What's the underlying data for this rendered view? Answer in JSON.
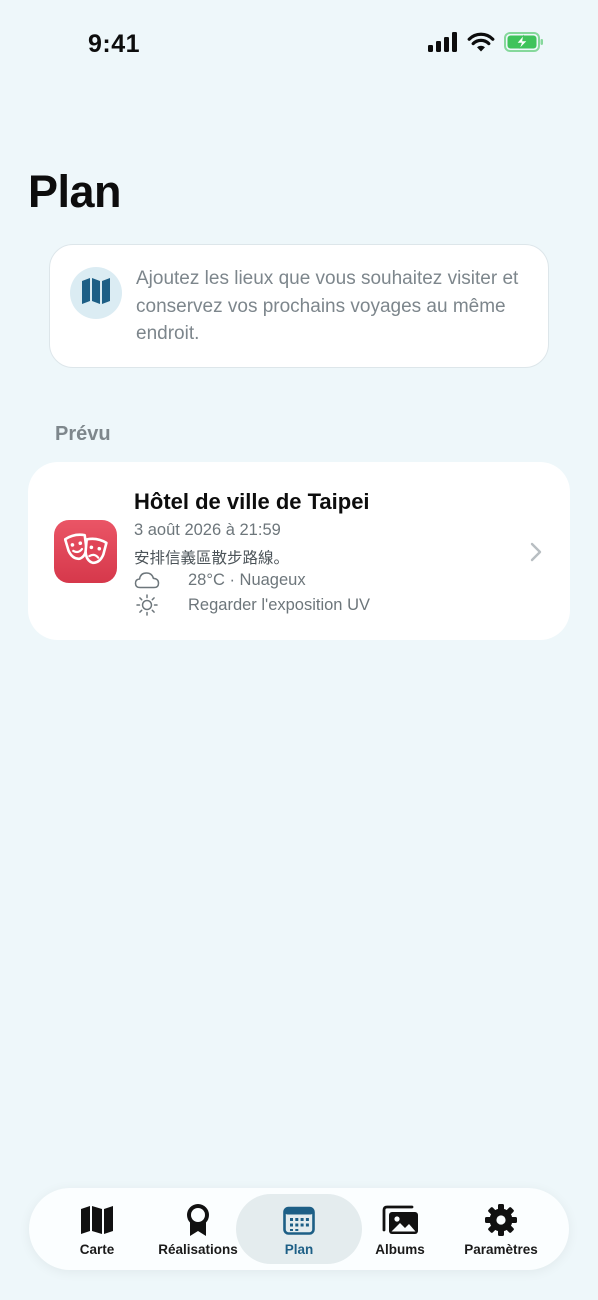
{
  "status_bar": {
    "time": "9:41",
    "icons": [
      "cellular-signal-icon",
      "wifi-icon",
      "battery-charging-icon"
    ],
    "battery_color": "#3fc35b"
  },
  "page": {
    "title": "Plan"
  },
  "info_card": {
    "icon": "map-icon",
    "text": "Ajoutez les lieux que vous souhaitez visiter et conservez vos prochains voyages au même endroit."
  },
  "planned": {
    "section_label": "Prévu",
    "items": [
      {
        "app_icon": "theater-masks-icon",
        "title": "Hôtel de ville de Taipei",
        "date": "3 août 2026 à 21:59",
        "note": "安排信義區散步路線。",
        "weather_icon": "cloud-icon",
        "weather": "28°C · Nuageux",
        "uv_icon": "sun-icon",
        "uv": "Regarder l'exposition UV"
      }
    ]
  },
  "tab_bar": {
    "active_tab": "Plan",
    "accent_color": "#1d5f86",
    "tabs": [
      {
        "label": "Carte",
        "icon": "map-icon"
      },
      {
        "label": "Réalisations",
        "icon": "award-ribbon-icon"
      },
      {
        "label": "Plan",
        "icon": "calendar-icon"
      },
      {
        "label": "Albums",
        "icon": "photo-albums-icon"
      },
      {
        "label": "Paramètres",
        "icon": "gear-icon"
      }
    ]
  }
}
